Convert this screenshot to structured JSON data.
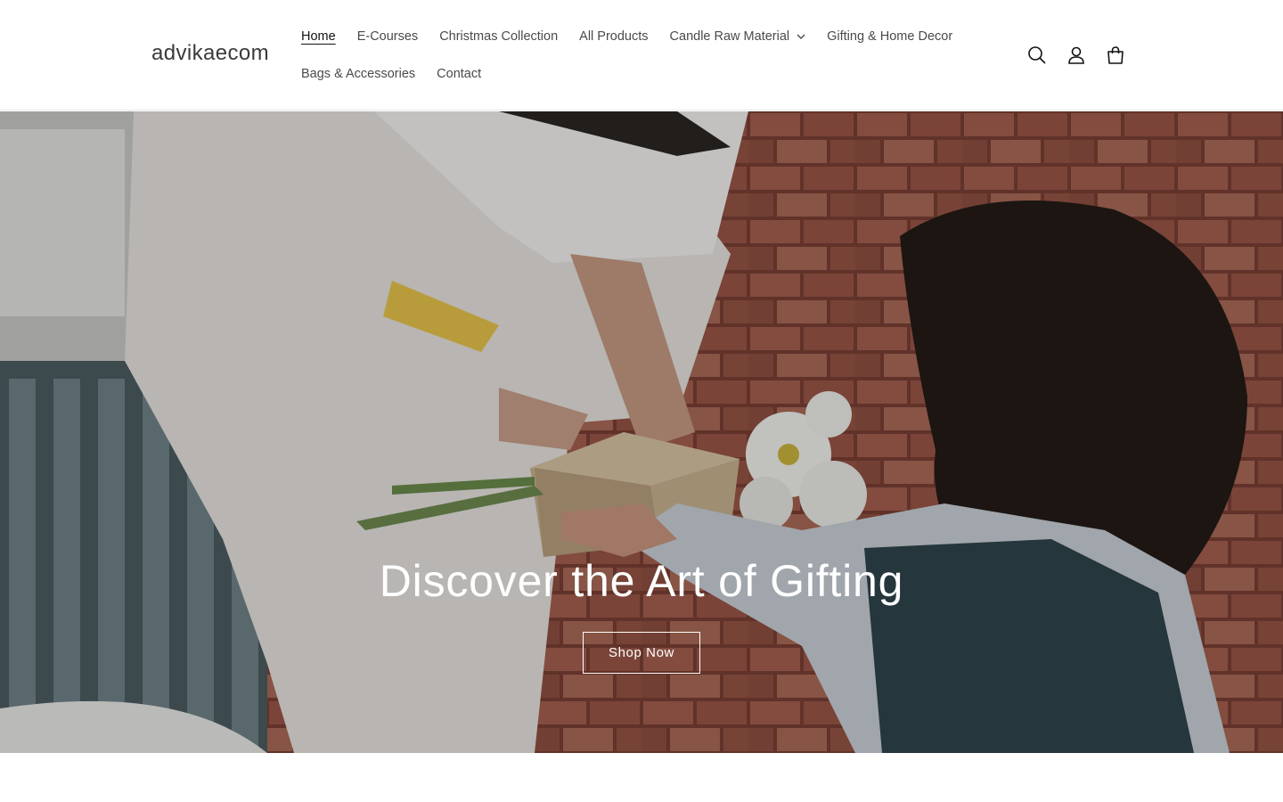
{
  "header": {
    "logo": "advikaecom",
    "nav_row1": [
      {
        "label": "Home",
        "active": true
      },
      {
        "label": "E-Courses"
      },
      {
        "label": "Christmas Collection"
      },
      {
        "label": "All Products"
      },
      {
        "label": "Candle Raw Material",
        "dropdown": true
      },
      {
        "label": "Gifting & Home Decor"
      }
    ],
    "nav_row2": [
      {
        "label": "Bags & Accessories"
      },
      {
        "label": "Contact"
      }
    ],
    "icons": [
      "search-icon",
      "account-icon",
      "cart-icon"
    ]
  },
  "hero": {
    "title": "Discover the Art of Gifting",
    "button_label": "Shop Now"
  },
  "colors": {
    "text": "#121212",
    "nav_text": "#4a4a4a",
    "hero_text": "#ffffff",
    "brick": "#9a5a4a"
  }
}
